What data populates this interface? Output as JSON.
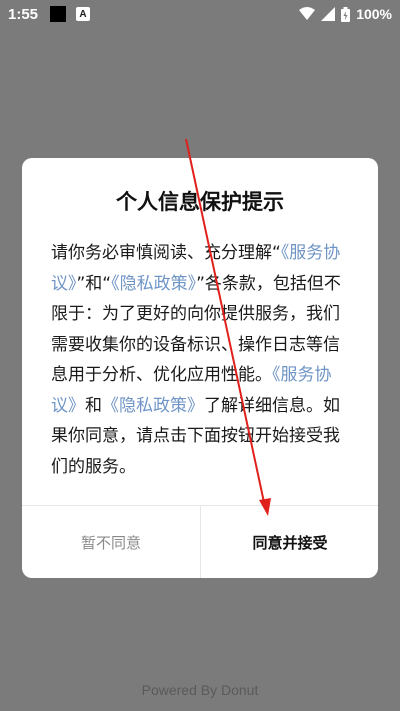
{
  "status_bar": {
    "time": "1:55",
    "notification_icon_letter": "A",
    "battery": "100%",
    "icons": [
      "wifi-icon",
      "signal-icon",
      "battery-icon"
    ]
  },
  "dialog": {
    "title": "个人信息保护提示",
    "body": {
      "t1": "请你务必审慎阅读、充分理解“",
      "link1": "《服务协议》",
      "t2": "”和“",
      "link2": "《隐私政策》",
      "t3": "”各条款，包括但不限于：为了更好的向你提供服务，我们需要收集你的设备标识、操作日志等信息用于分析、优化应用性能。",
      "link3": "《服务协议》",
      "t4": "和",
      "link4": "《隐私政策》",
      "t5": "了解详细信息。如果你同意，请点击下面按钮开始接受我们的服务。"
    },
    "decline_label": "暂不同意",
    "accept_label": "同意并接受"
  },
  "footer": "Powered By Donut",
  "colors": {
    "overlay": "#7b7b7b",
    "link": "#6f95c6",
    "annotation_arrow": "#e0201c"
  }
}
